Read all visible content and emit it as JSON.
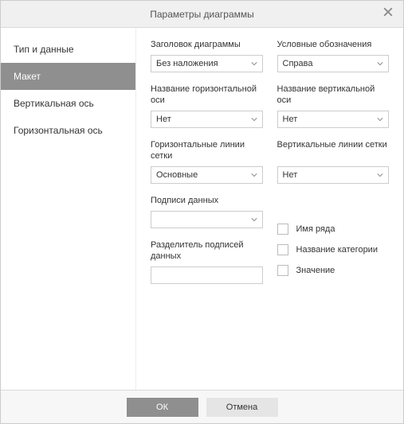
{
  "dialog": {
    "title": "Параметры диаграммы"
  },
  "sidebar": {
    "items": [
      {
        "label": "Тип и данные"
      },
      {
        "label": "Макет"
      },
      {
        "label": "Вертикальная ось"
      },
      {
        "label": "Горизонтальная ось"
      }
    ],
    "active_index": 1
  },
  "layout": {
    "chart_title": {
      "label": "Заголовок диаграммы",
      "value": "Без наложения"
    },
    "legend": {
      "label": "Условные обозначения",
      "value": "Справа"
    },
    "x_axis_title": {
      "label": "Название горизонтальной оси",
      "value": "Нет"
    },
    "y_axis_title": {
      "label": "Название вертикальной оси",
      "value": "Нет"
    },
    "h_gridlines": {
      "label": "Горизонтальные линии сетки",
      "value": "Основные"
    },
    "v_gridlines": {
      "label": "Вертикальные линии сетки",
      "value": "Нет"
    },
    "data_labels": {
      "label": "Подписи данных",
      "value": ""
    },
    "data_labels_sep": {
      "label": "Разделитель подписей данных",
      "value": ""
    },
    "series_name_cb": {
      "label": "Имя ряда"
    },
    "category_name_cb": {
      "label": "Название категории"
    },
    "value_cb": {
      "label": "Значение"
    }
  },
  "footer": {
    "ok": "ОК",
    "cancel": "Отмена"
  }
}
